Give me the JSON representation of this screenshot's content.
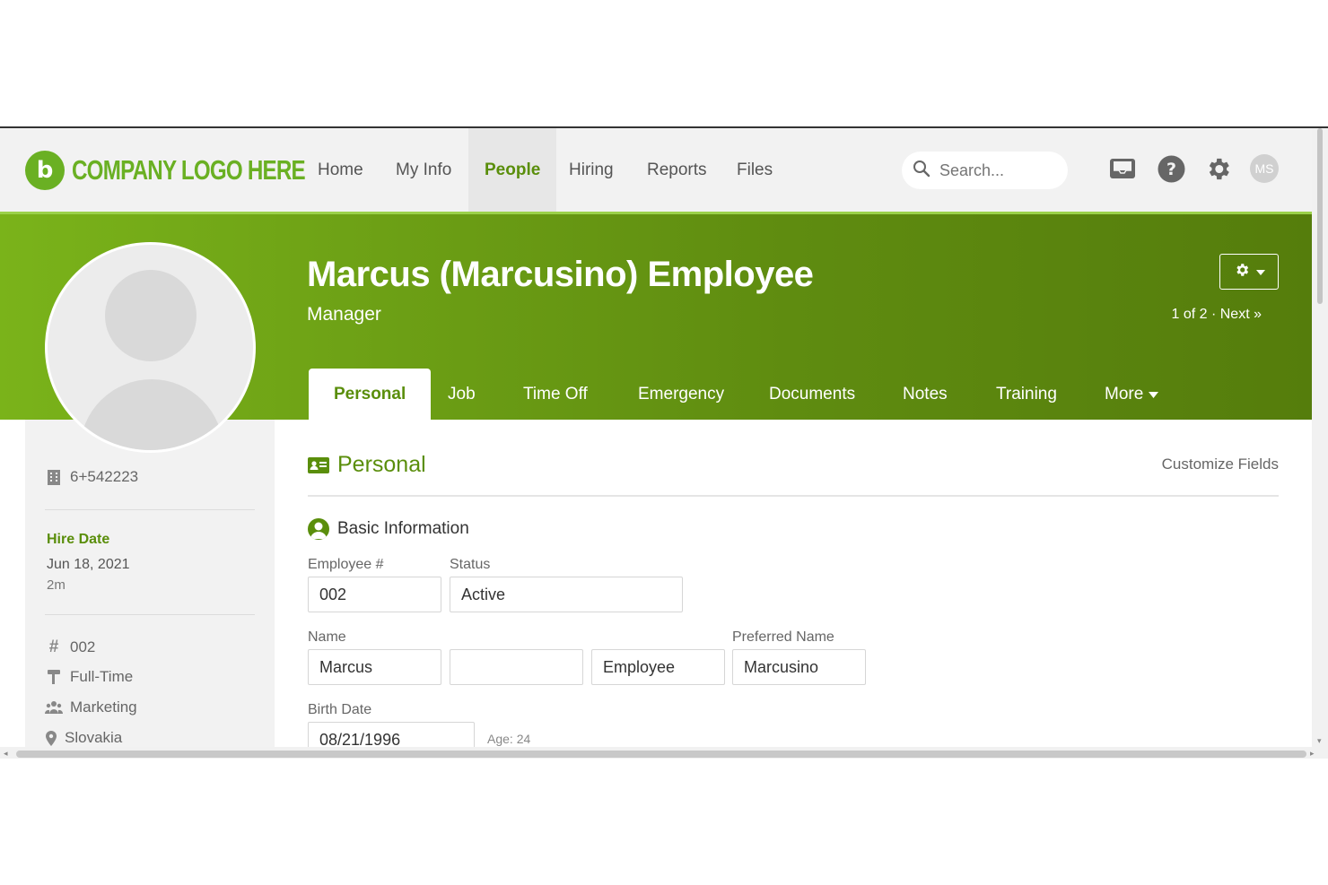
{
  "logo": {
    "badge": "b",
    "text": "COMPANY LOGO HERE"
  },
  "nav": {
    "items": [
      "Home",
      "My Info",
      "People",
      "Hiring",
      "Reports",
      "Files"
    ],
    "active": "People"
  },
  "search": {
    "placeholder": "Search..."
  },
  "user": {
    "initials": "MS"
  },
  "employee": {
    "name": "Marcus (Marcusino) Employee",
    "title": "Manager",
    "pager": "1 of 2",
    "next_label": "Next »"
  },
  "tabs": {
    "items": [
      "Personal",
      "Job",
      "Time Off",
      "Emergency",
      "Documents",
      "Notes",
      "Training",
      "More"
    ],
    "active": "Personal"
  },
  "sidebar": {
    "phone": "6+542223",
    "hire_label": "Hire Date",
    "hire_date": "Jun 18, 2021",
    "hire_duration": "2m",
    "employee_number": "002",
    "employment_type": "Full-Time",
    "department": "Marketing",
    "location": "Slovakia"
  },
  "main": {
    "section_title": "Personal",
    "customize_label": "Customize Fields",
    "subsection_title": "Basic Information",
    "labels": {
      "employee_number": "Employee #",
      "status": "Status",
      "name": "Name",
      "preferred_name": "Preferred Name",
      "birth_date": "Birth Date"
    },
    "values": {
      "employee_number": "002",
      "status": "Active",
      "first_name": "Marcus",
      "middle_name": "",
      "last_name": "Employee",
      "preferred_name": "Marcusino",
      "birth_date": "08/21/1996",
      "age": "Age: 24"
    }
  },
  "colors": {
    "brand_green": "#6ab023",
    "dark_green": "#5a8e0b",
    "band_start": "#7ab31a",
    "band_end": "#557d0c",
    "nav_bg": "#f2f2f2"
  }
}
